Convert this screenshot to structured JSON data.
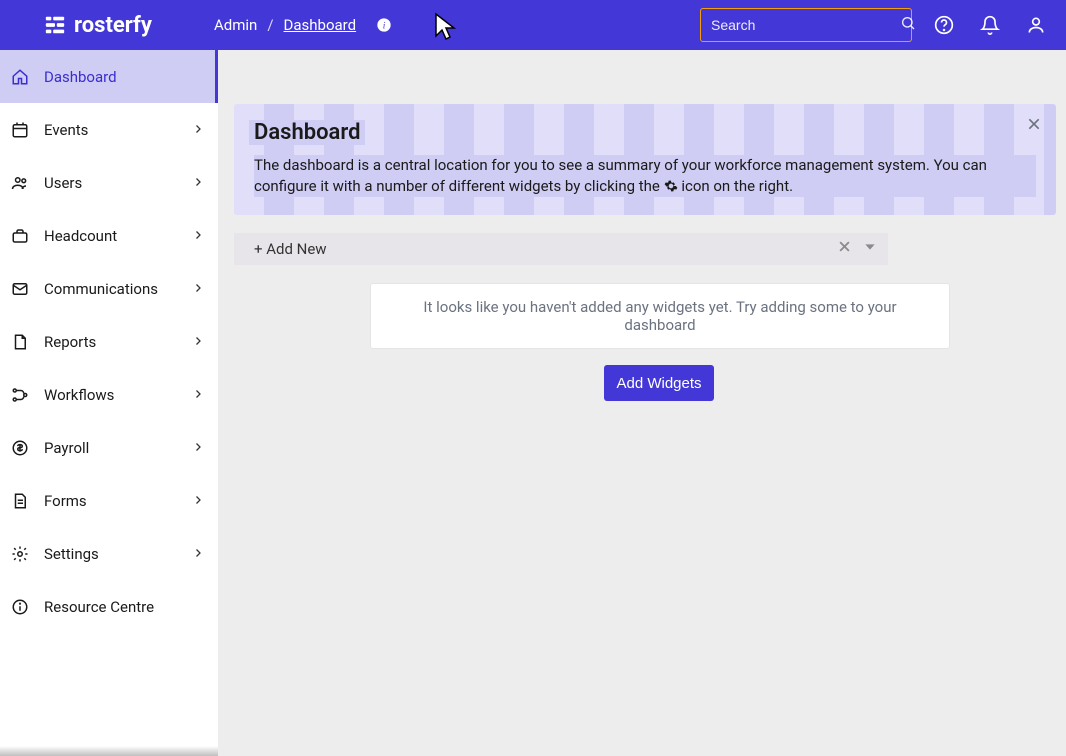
{
  "brand": {
    "name": "rosterfy"
  },
  "breadcrumb": {
    "root": "Admin",
    "sep": "/",
    "current": "Dashboard"
  },
  "search": {
    "placeholder": "Search"
  },
  "sidebar": {
    "items": [
      {
        "label": "Dashboard",
        "icon": "home",
        "active": true,
        "expandable": false
      },
      {
        "label": "Events",
        "icon": "calendar",
        "active": false,
        "expandable": true
      },
      {
        "label": "Users",
        "icon": "users",
        "active": false,
        "expandable": true
      },
      {
        "label": "Headcount",
        "icon": "briefcase",
        "active": false,
        "expandable": true
      },
      {
        "label": "Communications",
        "icon": "mail",
        "active": false,
        "expandable": true
      },
      {
        "label": "Reports",
        "icon": "file",
        "active": false,
        "expandable": true
      },
      {
        "label": "Workflows",
        "icon": "workflow",
        "active": false,
        "expandable": true
      },
      {
        "label": "Payroll",
        "icon": "dollar",
        "active": false,
        "expandable": true
      },
      {
        "label": "Forms",
        "icon": "form",
        "active": false,
        "expandable": true
      },
      {
        "label": "Settings",
        "icon": "gear",
        "active": false,
        "expandable": true
      },
      {
        "label": "Resource Centre",
        "icon": "info",
        "active": false,
        "expandable": false
      }
    ]
  },
  "banner": {
    "title": "Dashboard",
    "text_before": "The dashboard is a central location for you to see a summary of your workforce management system. You can configure it with a number of different widgets by clicking the ",
    "text_after": " icon on the right."
  },
  "section": {
    "add_new_label": "+ Add New"
  },
  "empty": {
    "message": "It looks like you haven't added any widgets yet. Try adding some to your dashboard",
    "button": "Add Widgets"
  }
}
